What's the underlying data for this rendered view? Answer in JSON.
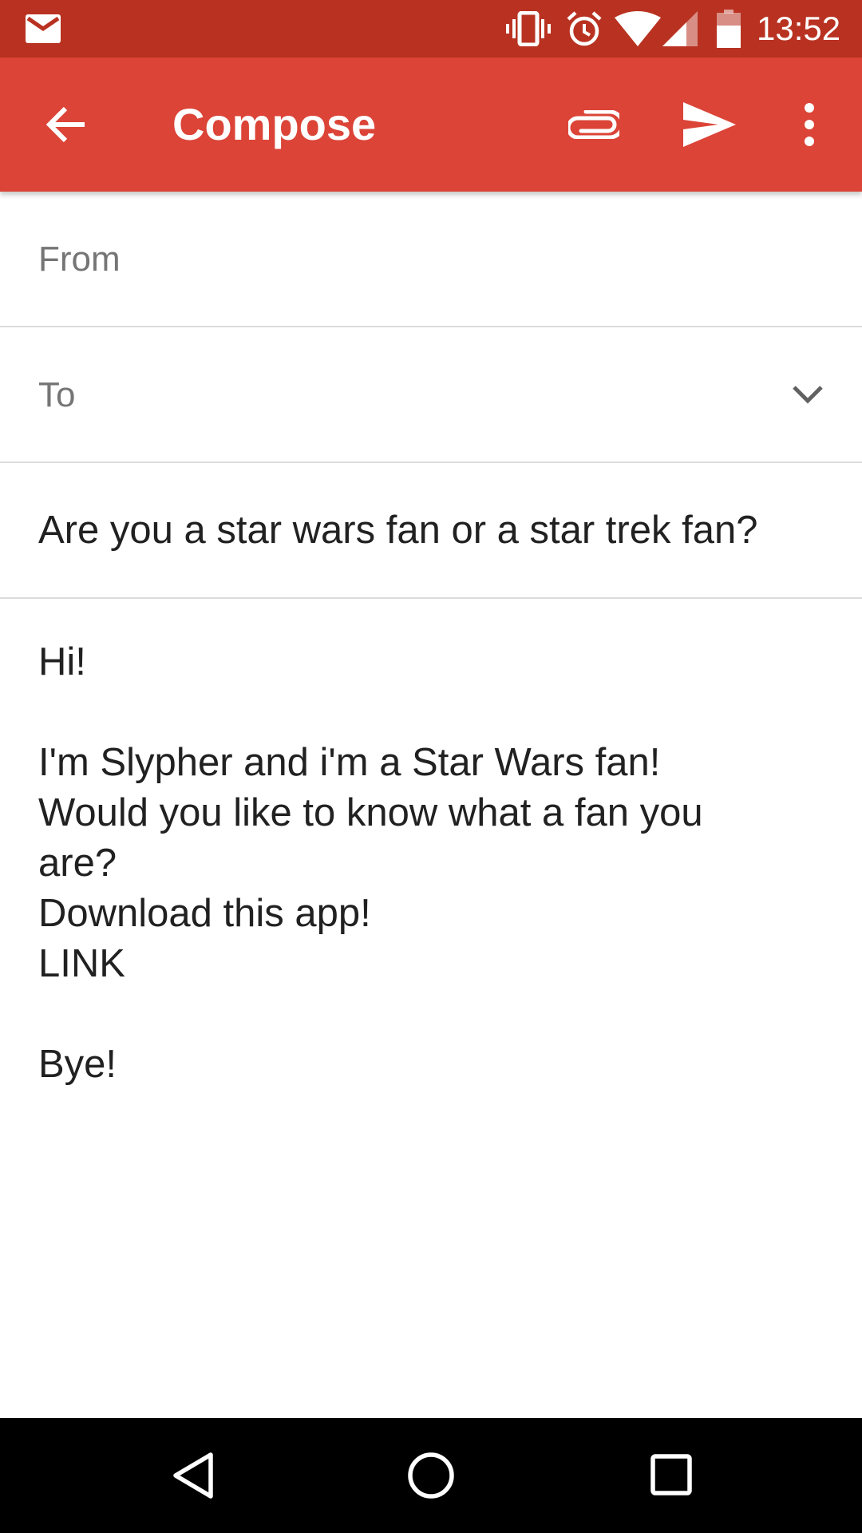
{
  "status_bar": {
    "time": "13:52",
    "icons": [
      "gmail-notification-icon",
      "vibrate-icon",
      "alarm-icon",
      "wifi-icon",
      "cellular-signal-icon",
      "battery-icon"
    ]
  },
  "app_bar": {
    "title": "Compose",
    "actions": [
      "back-arrow-icon",
      "attach-icon",
      "send-icon",
      "more-vert-icon"
    ]
  },
  "form": {
    "from_label": "From",
    "to_label": "To",
    "subject": "Are you a star wars fan or a star trek fan?"
  },
  "body": {
    "lines": [
      "Hi!",
      "",
      "I'm Slypher and i'm a Star Wars fan!",
      "Would you like to know what a fan you",
      "are?",
      "Download this app!",
      "LINK",
      "",
      "Bye!"
    ]
  },
  "nav_bar": {
    "buttons": [
      "nav-back-icon",
      "nav-home-icon",
      "nav-recents-icon"
    ]
  },
  "colors": {
    "status_bar": "#b93221",
    "app_bar": "#db4437",
    "nav_bar": "#000000"
  }
}
